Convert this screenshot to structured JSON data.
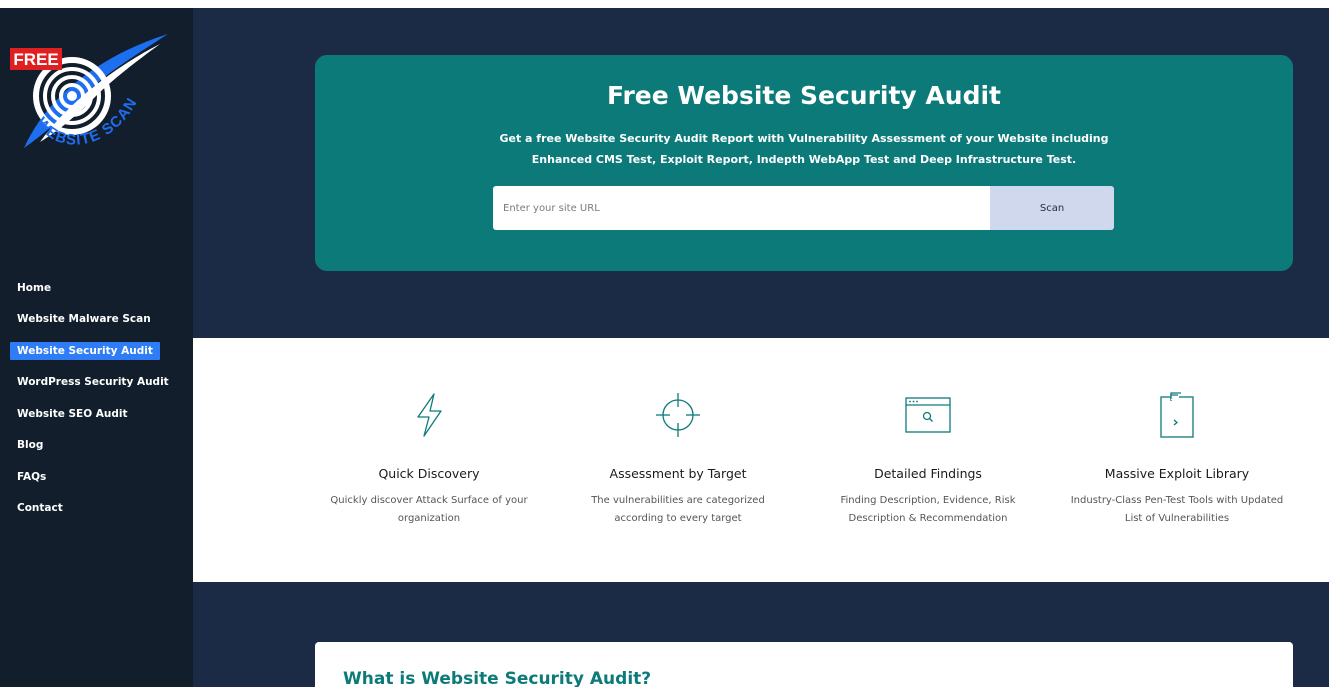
{
  "logo": {
    "badge": "FREE",
    "text": "WEBSITE SCAN"
  },
  "sidebar": {
    "items": [
      {
        "label": "Home",
        "active": false
      },
      {
        "label": "Website Malware Scan",
        "active": false
      },
      {
        "label": "Website Security Audit",
        "active": true
      },
      {
        "label": "WordPress Security Audit",
        "active": false
      },
      {
        "label": "Website SEO Audit",
        "active": false
      },
      {
        "label": "Blog",
        "active": false
      },
      {
        "label": "FAQs",
        "active": false
      },
      {
        "label": "Contact",
        "active": false
      }
    ]
  },
  "hero": {
    "title": "Free Website Security Audit",
    "description": "Get a free Website Security Audit Report with Vulnerability Assessment of your Website including Enhanced CMS Test, Exploit Report, Indepth WebApp Test and Deep Infrastructure Test.",
    "search_placeholder": "Enter your site URL",
    "scan_label": "Scan"
  },
  "features": [
    {
      "icon": "lightning-icon",
      "title": "Quick Discovery",
      "text": "Quickly discover Attack Surface of your organization"
    },
    {
      "icon": "crosshair-icon",
      "title": "Assessment by Target",
      "text": "The vulnerabilities are categorized according to every target"
    },
    {
      "icon": "browser-search-icon",
      "title": "Detailed Findings",
      "text": "Finding Description, Evidence, Risk Description & Recommendation"
    },
    {
      "icon": "clipboard-icon",
      "title": "Massive Exploit Library",
      "text": "Industry-Class Pen-Test Tools with Updated List of Vulnerabilities"
    }
  ],
  "section": {
    "heading": "What is Website Security Audit?"
  },
  "colors": {
    "sidebar_bg": "#121e2b",
    "page_bg": "#1b2b45",
    "hero_bg": "#0d7a7a",
    "active_nav": "#2f7df6",
    "accent_blue": "#1e6ef0",
    "badge_red": "#e02020",
    "icon_teal": "#0d7a7a"
  }
}
